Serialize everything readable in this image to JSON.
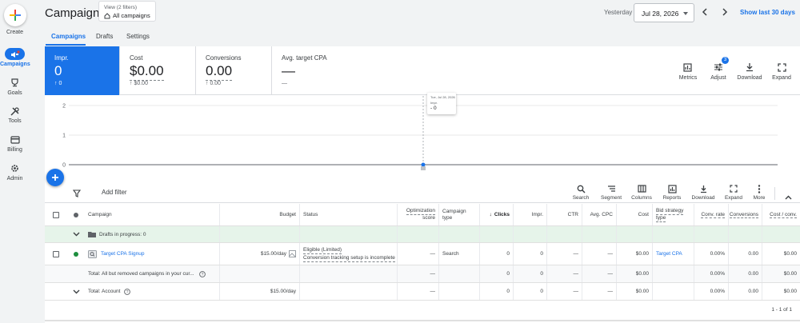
{
  "nav": {
    "create": "Create",
    "items": [
      {
        "label": "Campaigns",
        "icon": "megaphone-icon"
      },
      {
        "label": "Goals",
        "icon": "trophy-icon"
      },
      {
        "label": "Tools",
        "icon": "tools-icon"
      },
      {
        "label": "Billing",
        "icon": "credit-card-icon"
      },
      {
        "label": "Admin",
        "icon": "gear-icon"
      }
    ]
  },
  "header": {
    "title": "Campaigns",
    "view_filters": "View (2 filters)",
    "view_value": "All campaigns",
    "date_label": "Yesterday",
    "date_value": "Jul 28, 2026",
    "show_last": "Show last 30 days"
  },
  "tabs": [
    "Campaigns",
    "Drafts",
    "Settings"
  ],
  "scorecards": [
    {
      "title": "Impr.",
      "value": "0",
      "delta": "0"
    },
    {
      "title": "Cost",
      "value": "$0.00",
      "delta": "$0.00"
    },
    {
      "title": "Conversions",
      "value": "0.00",
      "delta": "0.00"
    },
    {
      "title": "Avg. target CPA",
      "value": "—",
      "delta": "—"
    }
  ],
  "chart_tools": [
    {
      "label": "Metrics",
      "icon": "metrics-icon"
    },
    {
      "label": "Adjust",
      "icon": "adjust-icon",
      "badge": "3"
    },
    {
      "label": "Download",
      "icon": "download-icon"
    },
    {
      "label": "Expand",
      "icon": "expand-icon"
    }
  ],
  "chart_data": {
    "type": "line",
    "y_ticks": [
      "2",
      "1",
      "0"
    ],
    "ylim": [
      0,
      2
    ],
    "points": [
      {
        "x": "Tue, Jul 28, 2026",
        "y": 0
      }
    ],
    "tooltip": {
      "date": "Tue, Jul 28, 2026",
      "metric": "Impr.",
      "value": "- 0"
    }
  },
  "toolbar": {
    "add_filter": "Add filter",
    "tools": [
      {
        "label": "Search",
        "icon": "search-icon"
      },
      {
        "label": "Segment",
        "icon": "segment-icon"
      },
      {
        "label": "Columns",
        "icon": "columns-icon"
      },
      {
        "label": "Reports",
        "icon": "reports-icon"
      },
      {
        "label": "Download",
        "icon": "download-icon"
      },
      {
        "label": "Expand",
        "icon": "expand-icon"
      },
      {
        "label": "More",
        "icon": "more-icon"
      }
    ]
  },
  "table": {
    "headers": {
      "campaign": "Campaign",
      "budget": "Budget",
      "status": "Status",
      "opt_score_1": "Optimization",
      "opt_score_2": "score",
      "campaign_type_1": "Campaign",
      "campaign_type_2": "type",
      "clicks": "Clicks",
      "impr": "Impr.",
      "ctr": "CTR",
      "avg_cpc": "Avg. CPC",
      "cost": "Cost",
      "bid_strategy_1": "Bid strategy",
      "bid_strategy_2": "type",
      "conv_rate": "Conv. rate",
      "conversions": "Conversions",
      "cost_conv": "Cost / conv."
    },
    "drafts": "Drafts in progress: 0",
    "campaign_row": {
      "name": "Target CPA Signup",
      "budget": "$15.00/day",
      "status_1": "Eligible (Limited)",
      "status_2": "Conversion tracking setup is incomplete",
      "opt_score": "—",
      "type": "Search",
      "clicks": "0",
      "impr": "0",
      "ctr": "—",
      "avg_cpc": "—",
      "cost": "$0.00",
      "bid_strategy": "Target CPA",
      "conv_rate": "0.00%",
      "conversions": "0.00",
      "cost_conv": "$0.00"
    },
    "total_removed": {
      "label": "Total: All but removed campaigns in your cur...",
      "opt_score": "—",
      "clicks": "0",
      "impr": "0",
      "ctr": "—",
      "avg_cpc": "—",
      "cost": "$0.00",
      "conv_rate": "0.00%",
      "conversions": "0.00",
      "cost_conv": "$0.00"
    },
    "total_account": {
      "label": "Total: Account",
      "budget": "$15.00/day",
      "opt_score": "—",
      "clicks": "0",
      "impr": "0",
      "ctr": "—",
      "avg_cpc": "—",
      "cost": "$0.00",
      "conv_rate": "0.00%",
      "conversions": "0.00",
      "cost_conv": "$0.00"
    },
    "pager": "1 - 1 of 1"
  },
  "colors": {
    "accent": "#1a73e8",
    "status_green": "#1e8e3e",
    "drafts_bg": "#e6f4ea"
  }
}
